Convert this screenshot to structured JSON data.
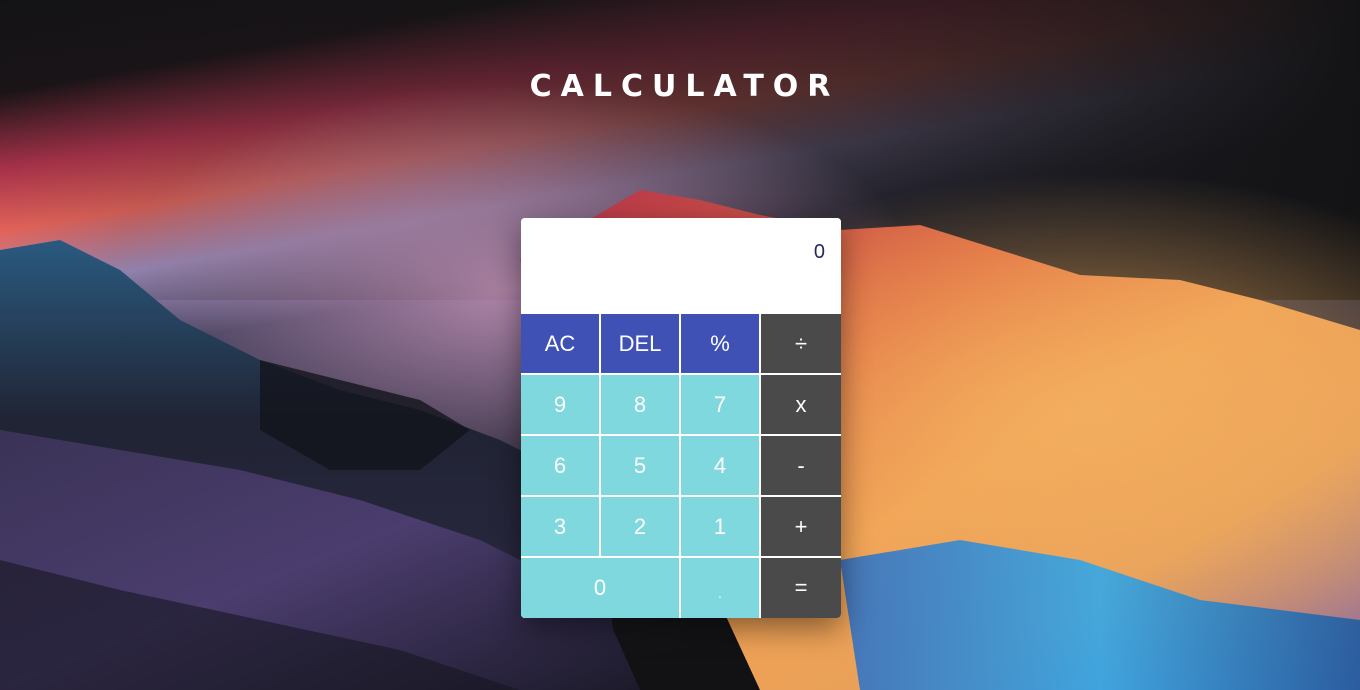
{
  "app": {
    "title": "CALCULATOR"
  },
  "display": {
    "value": "0"
  },
  "keys": {
    "ac": "AC",
    "del": "DEL",
    "percent": "%",
    "divide": "÷",
    "nine": "9",
    "eight": "8",
    "seven": "7",
    "multiply": "x",
    "six": "6",
    "five": "5",
    "four": "4",
    "minus": "-",
    "three": "3",
    "two": "2",
    "one": "1",
    "plus": "+",
    "zero": "0",
    "dot": ".",
    "equals": "="
  },
  "colors": {
    "function_keys": "#3f51b5",
    "number_keys": "#80d8df",
    "operator_keys": "#4a4a4a",
    "display_text": "#25285e"
  }
}
